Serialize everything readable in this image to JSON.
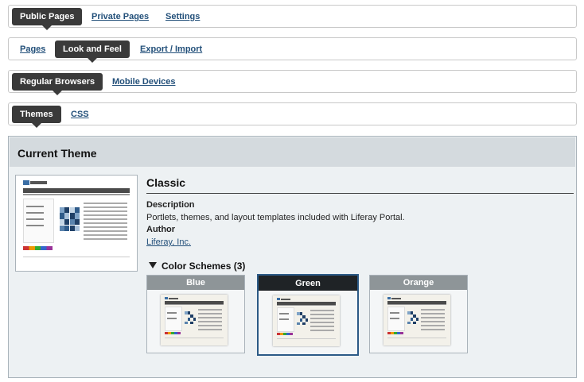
{
  "tabs_row1": {
    "public_pages": "Public Pages",
    "private_pages": "Private Pages",
    "settings": "Settings"
  },
  "tabs_row2": {
    "pages": "Pages",
    "look_and_feel": "Look and Feel",
    "export_import": "Export / Import"
  },
  "tabs_row3": {
    "regular_browsers": "Regular Browsers",
    "mobile_devices": "Mobile Devices"
  },
  "tabs_row4": {
    "themes": "Themes",
    "css": "CSS"
  },
  "current_theme": {
    "heading": "Current Theme",
    "name": "Classic",
    "description_label": "Description",
    "description": "Portlets, themes, and layout templates included with Liferay Portal.",
    "author_label": "Author",
    "author": "Liferay, Inc."
  },
  "color_schemes": {
    "toggle_label": "Color Schemes (3)",
    "items": [
      {
        "label": "Blue",
        "selected": false
      },
      {
        "label": "Green",
        "selected": true
      },
      {
        "label": "Orange",
        "selected": false
      }
    ]
  },
  "colors": {
    "active_tab": "#3a3a3a",
    "link": "#23507a",
    "selected_border": "#2c5a86"
  }
}
